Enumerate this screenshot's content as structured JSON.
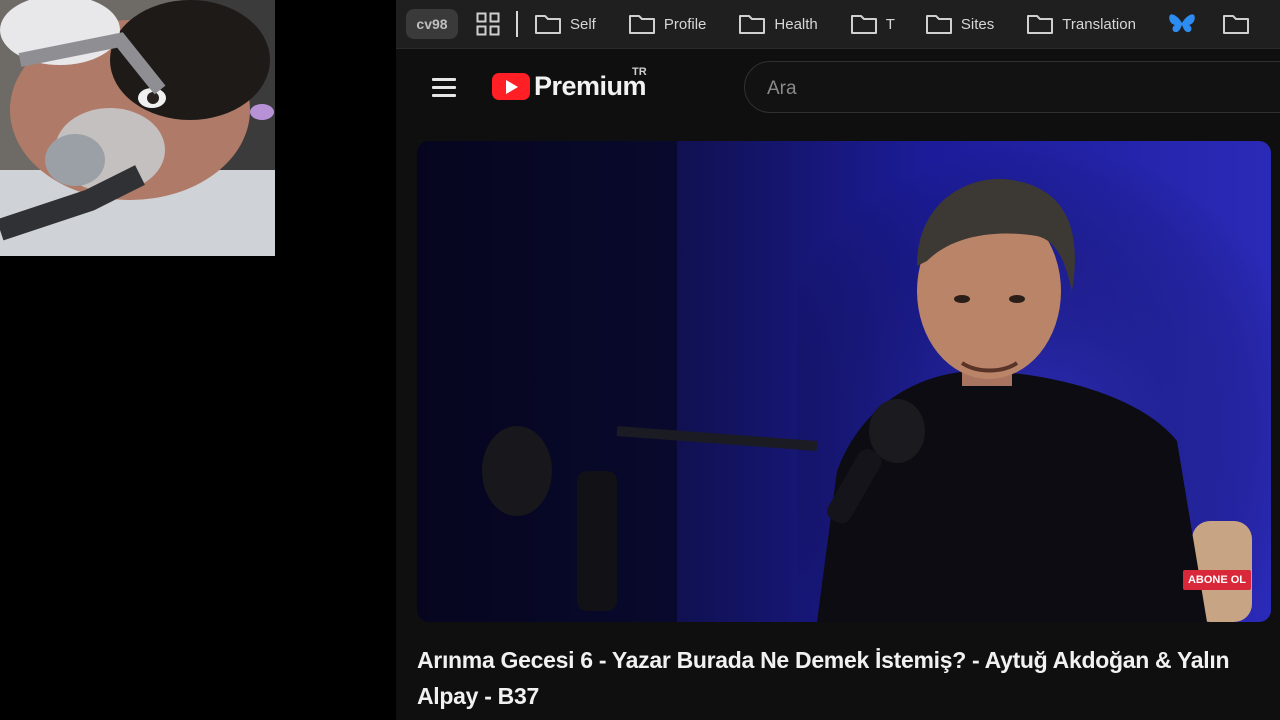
{
  "bookmarks_bar": {
    "profile_label": "cv98",
    "apps_icon": "grid-icon",
    "folders": [
      {
        "label": "Self",
        "icon": "folder-icon"
      },
      {
        "label": "Profile",
        "icon": "folder-icon"
      },
      {
        "label": "Health",
        "icon": "folder-icon"
      },
      {
        "label": "T",
        "icon": "folder-icon"
      },
      {
        "label": "Sites",
        "icon": "folder-icon"
      },
      {
        "label": "Translation",
        "icon": "folder-icon"
      }
    ],
    "butterfly_icon": "bluesky-butterfly-icon",
    "butterfly_color": "#2d8cf0"
  },
  "masthead": {
    "menu_icon": "hamburger-menu-icon",
    "logo_word": "Premium",
    "region_code": "TR",
    "brand_red": "#ff1f24",
    "search_placeholder": "Ara"
  },
  "video": {
    "subscribe_badge": "ABONE OL",
    "title": "Arınma Gecesi 6 - Yazar Burada Ne Demek İstemiş? - Aytuğ Akdoğan & Yalın Alpay - B37"
  },
  "colors": {
    "background": "#000000",
    "page_bg": "#0f0f0f",
    "bar_bg": "#1f1f1f",
    "studio_blue": "#1c1c9a",
    "subscribe_red": "#d8283a"
  }
}
